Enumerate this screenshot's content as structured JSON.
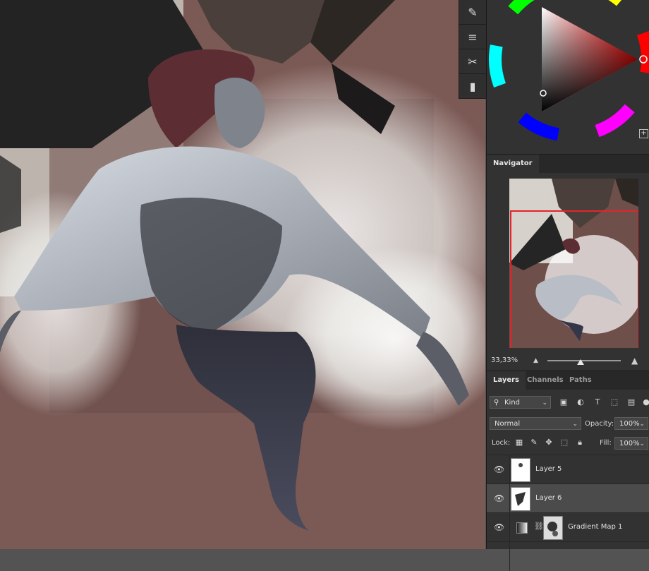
{
  "tools": [
    {
      "name": "brush-tool",
      "icon": "brush-icon",
      "glyph": "✎"
    },
    {
      "name": "clone-stamp-tool",
      "icon": "clone-stamp-icon",
      "glyph": "≡"
    },
    {
      "name": "tools-settings",
      "icon": "scissors-icon",
      "glyph": "✂"
    },
    {
      "name": "note-tool",
      "icon": "note-icon",
      "glyph": "▮"
    }
  ],
  "color_panel": {
    "add_label": "+",
    "selected_hue": "#ff0000"
  },
  "navigator": {
    "tab": "Navigator",
    "zoom": "33,33%",
    "zoom_level": 0.4,
    "viewbox_color": "#e0262b"
  },
  "layers_panel": {
    "tabs": [
      "Layers",
      "Channels",
      "Paths"
    ],
    "filter": {
      "label": "Kind",
      "icons": [
        "image-filter-icon",
        "adjustment-filter-icon",
        "type-filter-icon",
        "shape-filter-icon",
        "smart-object-filter-icon"
      ]
    },
    "blend_mode": "Normal",
    "opacity_label": "Opacity:",
    "opacity_value": "100%",
    "lock_label": "Lock:",
    "fill_label": "Fill:",
    "fill_value": "100%",
    "layers": [
      {
        "name": "Layer 5",
        "visible": true,
        "selected": false
      },
      {
        "name": "Layer 6",
        "visible": true,
        "selected": true
      },
      {
        "name": "Gradient Map 1",
        "visible": true,
        "selected": false
      }
    ]
  }
}
